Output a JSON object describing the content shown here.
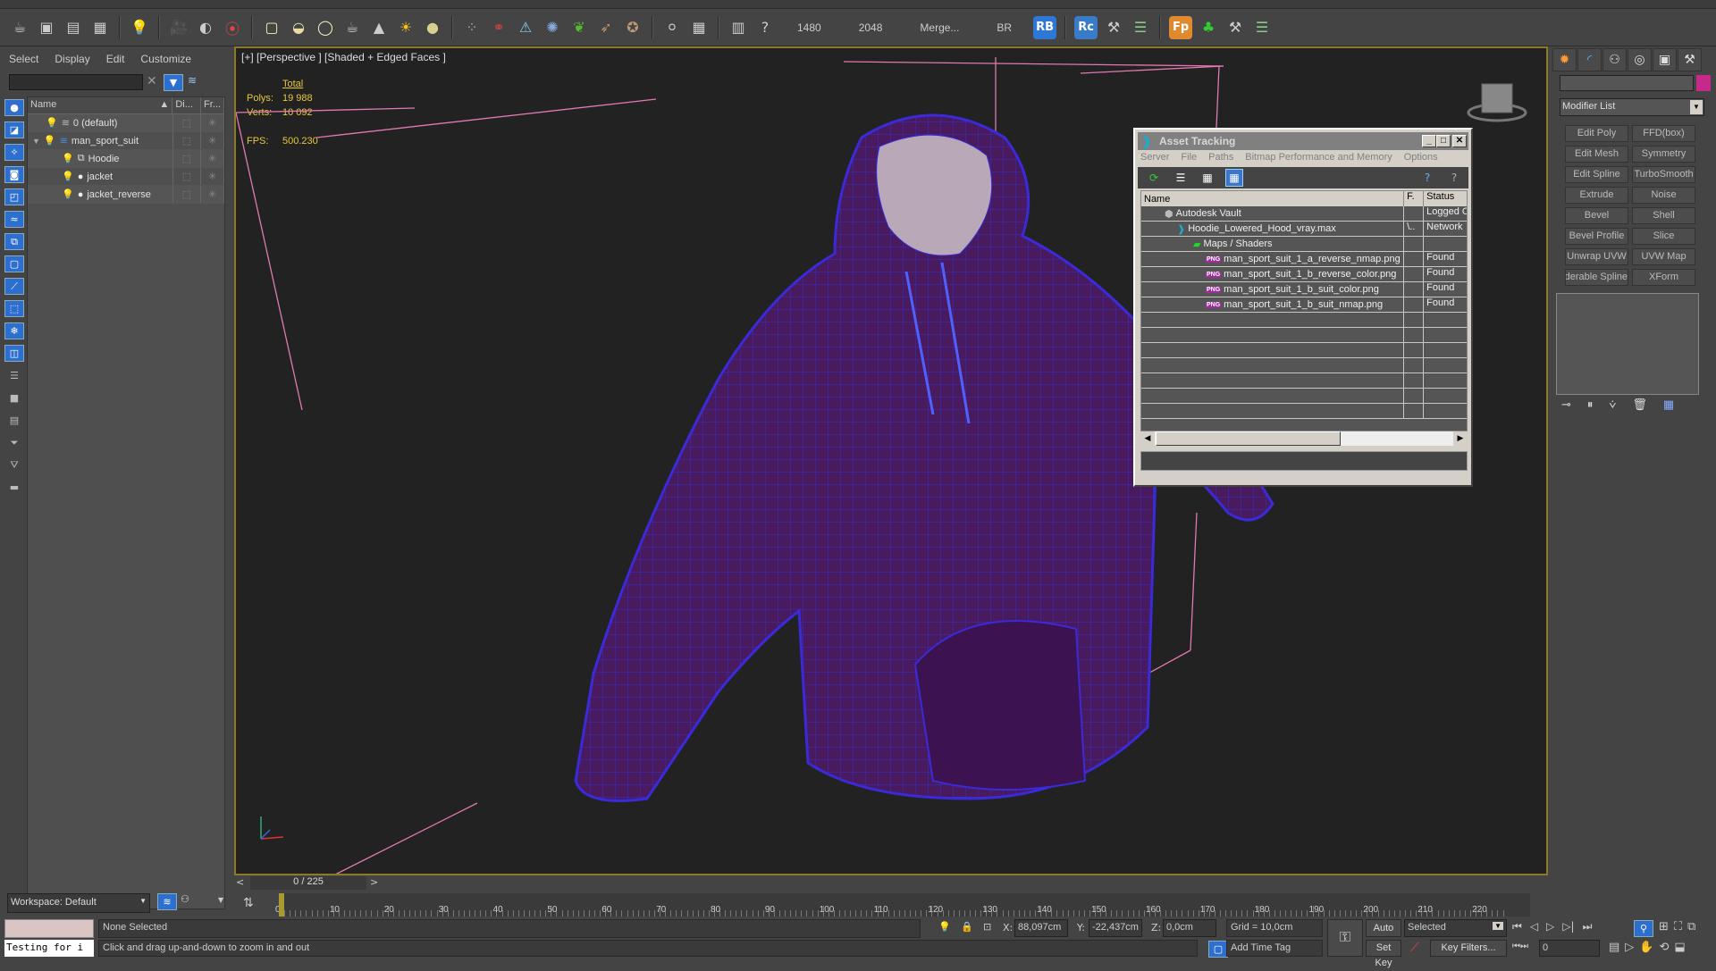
{
  "toolbar": {
    "numbers": [
      "1480",
      "2048"
    ],
    "merge_label": "Merge...",
    "br_label": "BR",
    "badges": {
      "rb": "RB",
      "rc": "Rc",
      "fp": "Fp"
    },
    "colors": {
      "rb": "#2f77d4",
      "rc": "#3a7bc8",
      "fp": "#e08a30"
    }
  },
  "scene_explorer": {
    "menu": [
      "Select",
      "Display",
      "Edit",
      "Customize"
    ],
    "columns": [
      "Name",
      "Di...",
      "Fr..."
    ],
    "rows": [
      {
        "name": "0 (default)",
        "type": "layer",
        "indent": 0
      },
      {
        "name": "man_sport_suit",
        "type": "layer-active",
        "indent": 0,
        "expanded": true
      },
      {
        "name": "Hoodie",
        "type": "group",
        "indent": 1
      },
      {
        "name": "jacket",
        "type": "object",
        "indent": 1
      },
      {
        "name": "jacket_reverse",
        "type": "object",
        "indent": 1
      }
    ],
    "workspace": "Workspace: Default"
  },
  "viewport": {
    "label": "[+] [Perspective ] [Shaded + Edged Faces ]",
    "stats": {
      "total_label": "Total",
      "polys_label": "Polys:",
      "polys": "19 988",
      "verts_label": "Verts:",
      "verts": "10 092",
      "fps_label": "FPS:",
      "fps": "500.230"
    }
  },
  "asset_tracking": {
    "title": "Asset Tracking",
    "menu": [
      "Server",
      "File",
      "Paths",
      "Bitmap Performance and Memory",
      "Options"
    ],
    "columns": [
      "Name",
      "F.",
      "Status"
    ],
    "rows": [
      {
        "name": "Autodesk Vault",
        "f": "",
        "status": "Logged Out",
        "indent": 1,
        "icon": "vault"
      },
      {
        "name": "Hoodie_Lowered_Hood_vray.max",
        "f": "\\..",
        "status": "Network",
        "indent": 2,
        "icon": "max"
      },
      {
        "name": "Maps / Shaders",
        "f": "",
        "status": "",
        "indent": 3,
        "icon": "maps"
      },
      {
        "name": "man_sport_suit_1_a_reverse_nmap.png",
        "f": "",
        "status": "Found",
        "indent": 4,
        "icon": "png"
      },
      {
        "name": "man_sport_suit_1_b_reverse_color.png",
        "f": "",
        "status": "Found",
        "indent": 4,
        "icon": "png"
      },
      {
        "name": "man_sport_suit_1_b_suit_color.png",
        "f": "",
        "status": "Found",
        "indent": 4,
        "icon": "png"
      },
      {
        "name": "man_sport_suit_1_b_suit_nmap.png",
        "f": "",
        "status": "Found",
        "indent": 4,
        "icon": "png"
      }
    ],
    "png_badge": "PNG"
  },
  "command_panel": {
    "modifier_list": "Modifier List",
    "object_color": "#c52a8a",
    "buttons": [
      "Edit Poly",
      "FFD(box)",
      "Edit Mesh",
      "Symmetry",
      "Edit Spline",
      "TurboSmooth",
      "Extrude",
      "Noise",
      "Bevel",
      "Shell",
      "Bevel Profile",
      "Slice",
      "Unwrap UVW",
      "UVW Map",
      "Renderable Spline",
      "XForm"
    ]
  },
  "timeline": {
    "frame": "0 / 225",
    "ticks": [
      "0",
      "10",
      "20",
      "30",
      "40",
      "50",
      "60",
      "70",
      "80",
      "90",
      "100",
      "110",
      "120",
      "130",
      "140",
      "150",
      "160",
      "170",
      "180",
      "190",
      "200",
      "210",
      "220"
    ]
  },
  "status": {
    "maxscript_text": "Testing for i",
    "selection": "None Selected",
    "prompt": "Click and drag up-and-down to zoom in and out",
    "x_label": "X:",
    "x": "88,097cm",
    "y_label": "Y:",
    "y": "-22,437cm",
    "z_label": "Z:",
    "z": "0,0cm",
    "grid": "Grid = 10,0cm",
    "add_time_tag": "Add Time Tag",
    "auto_key": "Auto Key",
    "set_key": "Set Key",
    "key_mode": "Selected",
    "key_filters": "Key Filters...",
    "current_frame": "0"
  }
}
